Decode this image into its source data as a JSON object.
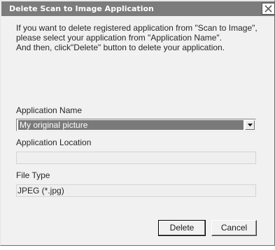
{
  "window": {
    "title": "Delete Scan to Image Application"
  },
  "instructions": {
    "line1": "If you want to delete registered application from \"Scan to Image\", please select your application from \"Application Name\".",
    "line2": "And then, click\"Delete\" button to delete your application."
  },
  "application_name": {
    "label": "Application Name",
    "selected": "My original picture"
  },
  "application_location": {
    "label": "Application Location",
    "value": ""
  },
  "file_type": {
    "label": "File Type",
    "value": "JPEG (*.jpg)"
  },
  "buttons": {
    "delete": "Delete",
    "cancel": "Cancel"
  },
  "icons": {
    "close": "close-icon",
    "dropdown": "chevron-down-icon"
  }
}
